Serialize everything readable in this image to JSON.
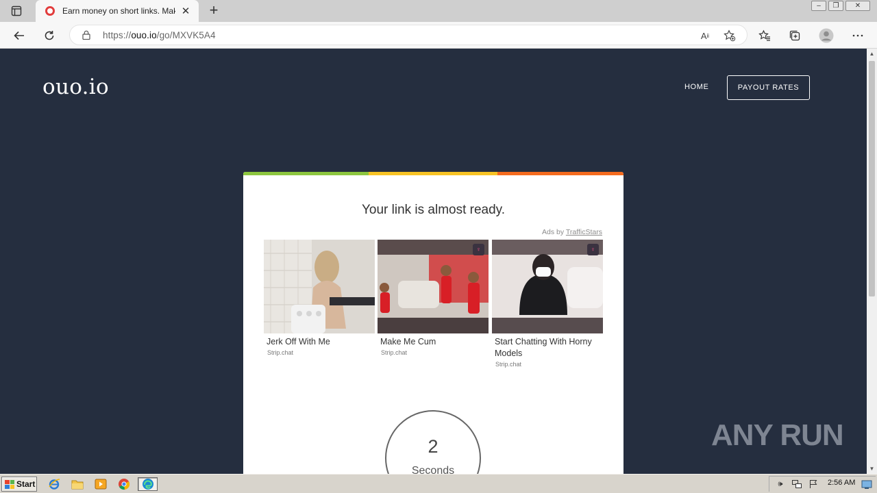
{
  "browser": {
    "tab_title": "Earn money on short links. Mak",
    "new_tab_label": "+",
    "url_prefix": "https://",
    "url_host": "ouo.io",
    "url_path": "/go/MXVK5A4"
  },
  "site": {
    "logo": "ouo.io",
    "nav_home": "HOME",
    "nav_payout": "PAYOUT RATES"
  },
  "card": {
    "title": "Your link is almost ready.",
    "ads_by_prefix": "Ads by",
    "ads_by_link": "TrafficStars",
    "stripe_colors": [
      "#8dc63f",
      "#f7c325",
      "#f46b1f"
    ],
    "ads": [
      {
        "title": "Jerk Off With Me",
        "source": "Strip.chat"
      },
      {
        "title": "Make Me Cum",
        "source": "Strip.chat"
      },
      {
        "title": "Start Chatting With Horny Models",
        "source": "Strip.chat"
      }
    ],
    "timer_value": "2",
    "timer_label": "Seconds"
  },
  "watermark": "ANY RUN",
  "taskbar": {
    "start_label": "Start",
    "clock": "2:56 AM"
  },
  "colors": {
    "page_bg": "#252e3f",
    "card_bg": "#ffffff"
  }
}
